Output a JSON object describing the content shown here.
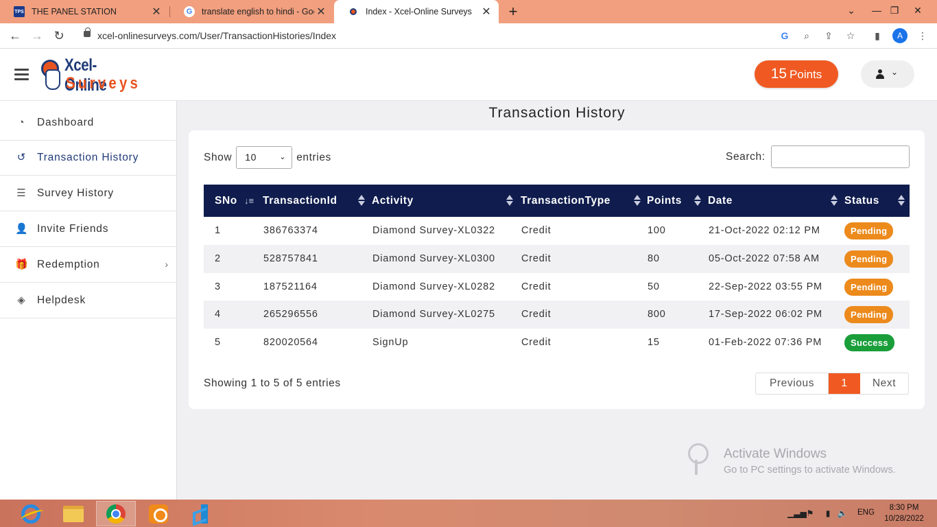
{
  "browser": {
    "tabs": [
      {
        "title": "THE PANEL STATION",
        "favicon": "TPS",
        "active": false
      },
      {
        "title": "translate english to hindi - Goog",
        "favicon": "G",
        "active": false
      },
      {
        "title": "Index - Xcel-Online Surveys",
        "favicon": "xcel-icon",
        "active": true
      }
    ],
    "url": "xcel-onlinesurveys.com/User/TransactionHistories/Index",
    "profile_initial": "A"
  },
  "header": {
    "logo_line1": "Xcel-Online",
    "logo_line2": "Surveys",
    "points_value": "15",
    "points_label": "Points"
  },
  "sidebar": {
    "items": [
      {
        "label": "Dashboard",
        "icon": "dashboard-icon",
        "active": false
      },
      {
        "label": "Transaction History",
        "icon": "history-icon",
        "active": true
      },
      {
        "label": "Survey History",
        "icon": "list-icon",
        "active": false
      },
      {
        "label": "Invite Friends",
        "icon": "user-plus-icon",
        "active": false
      },
      {
        "label": "Redemption",
        "icon": "gift-icon",
        "active": false,
        "has_submenu": true
      },
      {
        "label": "Helpdesk",
        "icon": "ticket-icon",
        "active": false
      }
    ]
  },
  "main": {
    "title": "Transaction History",
    "show_label": "Show",
    "entries_label": "entries",
    "page_size": "10",
    "search_label": "Search:",
    "search_value": "",
    "columns": [
      "SNo",
      "TransactionId",
      "Activity",
      "TransactionType",
      "Points",
      "Date",
      "Status"
    ],
    "rows": [
      {
        "sno": "1",
        "id": "386763374",
        "activity": "Diamond Survey-XL0322",
        "type": "Credit",
        "points": "100",
        "date": "21-Oct-2022 02:12 PM",
        "status": "Pending"
      },
      {
        "sno": "2",
        "id": "528757841",
        "activity": "Diamond Survey-XL0300",
        "type": "Credit",
        "points": "80",
        "date": "05-Oct-2022 07:58 AM",
        "status": "Pending"
      },
      {
        "sno": "3",
        "id": "187521164",
        "activity": "Diamond Survey-XL0282",
        "type": "Credit",
        "points": "50",
        "date": "22-Sep-2022 03:55 PM",
        "status": "Pending"
      },
      {
        "sno": "4",
        "id": "265296556",
        "activity": "Diamond Survey-XL0275",
        "type": "Credit",
        "points": "800",
        "date": "17-Sep-2022 06:02 PM",
        "status": "Pending"
      },
      {
        "sno": "5",
        "id": "820020564",
        "activity": "SignUp",
        "type": "Credit",
        "points": "15",
        "date": "01-Feb-2022 07:36 PM",
        "status": "Success"
      }
    ],
    "info": "Showing 1 to 5 of 5 entries",
    "pagination": {
      "previous": "Previous",
      "current": "1",
      "next": "Next"
    }
  },
  "colors": {
    "accent": "#f05a22",
    "header_bg": "#0f1c4d",
    "pending": "#ec8a1c",
    "success": "#1a9e3a"
  },
  "watermark": {
    "title": "Activate Windows",
    "subtitle": "Go to PC settings to activate Windows."
  },
  "taskbar": {
    "apps": [
      "internet-explorer-icon",
      "file-explorer-icon",
      "chrome-icon",
      "uc-browser-icon",
      "vscode-icon"
    ],
    "language": "ENG",
    "time": "8:30 PM",
    "date": "10/28/2022"
  }
}
